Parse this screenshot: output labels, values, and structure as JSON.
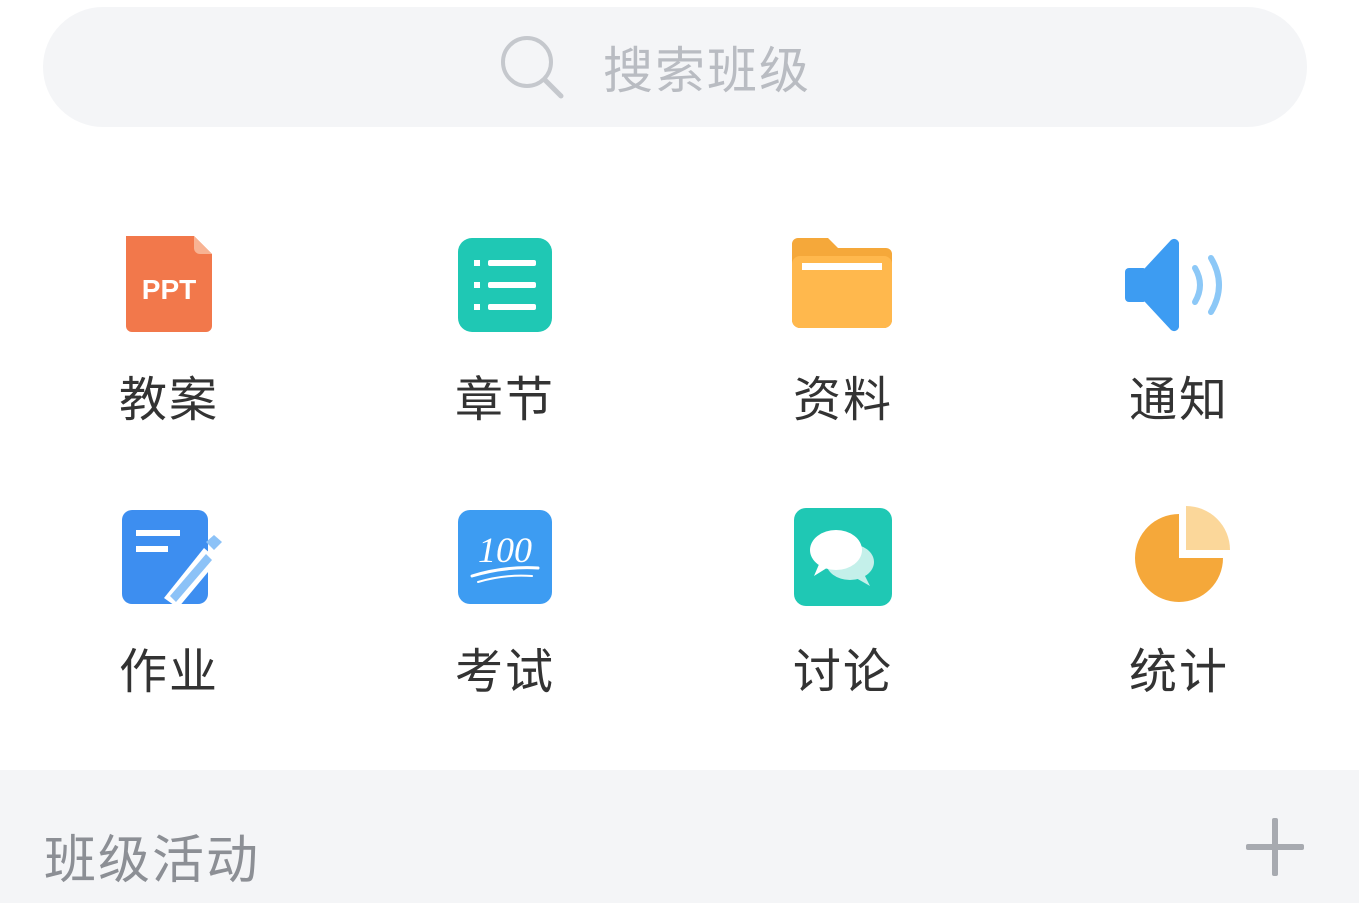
{
  "search": {
    "placeholder": "搜索班级",
    "icon": "search-icon"
  },
  "grid": {
    "items": [
      {
        "label": "教案",
        "icon": "ppt-icon",
        "color": "#f2784b",
        "icon_text": "PPT"
      },
      {
        "label": "章节",
        "icon": "list-icon",
        "color": "#1fc8b4"
      },
      {
        "label": "资料",
        "icon": "folder-icon",
        "color": "#fbb040"
      },
      {
        "label": "通知",
        "icon": "speaker-icon",
        "color": "#3d9cf2"
      },
      {
        "label": "作业",
        "icon": "edit-document-icon",
        "color": "#3d8ef0"
      },
      {
        "label": "考试",
        "icon": "score-100-icon",
        "color": "#3d9cf2",
        "icon_text": "100"
      },
      {
        "label": "讨论",
        "icon": "chat-bubbles-icon",
        "color": "#1fc8b4"
      },
      {
        "label": "统计",
        "icon": "pie-chart-icon",
        "color": "#f5a83a"
      }
    ]
  },
  "section": {
    "title": "班级活动",
    "add_icon": "plus-icon"
  }
}
